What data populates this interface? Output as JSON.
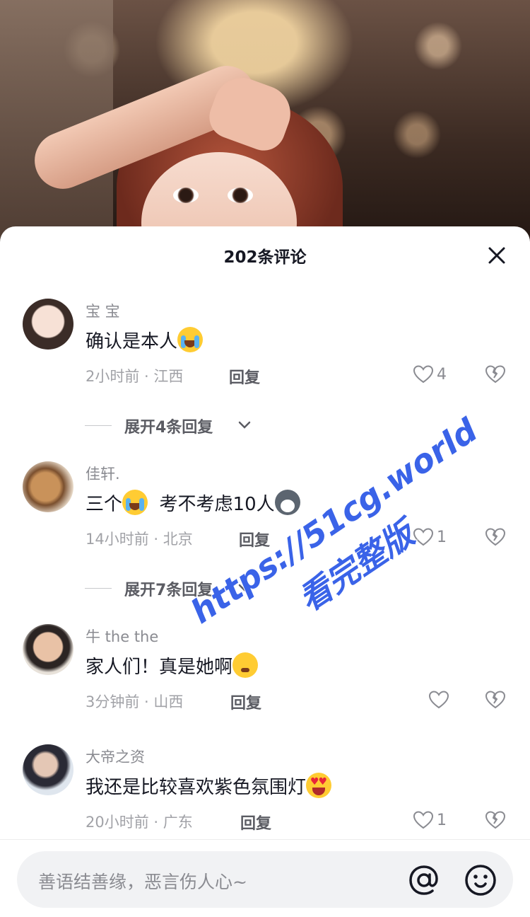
{
  "sheet": {
    "title": "202条评论"
  },
  "comments": [
    {
      "user": "宝 宝",
      "text": "确认是本人",
      "emoji": "cry-laugh-emoji",
      "time_location": "2小时前 · 江西",
      "reply_label": "回复",
      "likes": "4"
    },
    {
      "user": "佳轩.",
      "text": "三个",
      "emoji": "cry-laugh-emoji",
      "text2": "考不考虑10人",
      "emoji2": "dog-emoji",
      "time_location": "14小时前 · 北京",
      "reply_label": "回复",
      "likes": "1"
    },
    {
      "user": "牛 the the",
      "text": "家人们！真是她啊",
      "emoji": "pleading-emoji",
      "time_location": "3分钟前 · 山西",
      "reply_label": "回复",
      "likes": ""
    },
    {
      "user": "大帝之资",
      "text": "我还是比较喜欢紫色氛围灯",
      "emoji": "heart-eyes-emoji",
      "time_location": "20小时前 · 广东",
      "reply_label": "回复",
      "likes": "1"
    }
  ],
  "expand_replies": [
    {
      "label": "展开4条回复"
    },
    {
      "label": "展开7条回复"
    }
  ],
  "watermark": {
    "line1": "https://51cg.world",
    "line2": "看完整版"
  },
  "input": {
    "placeholder": "善语结善缘，恶言伤人心~"
  },
  "colors": {
    "watermark": "#3a63e8",
    "muted_text": "#8a8b91",
    "primary_text": "#161823"
  }
}
